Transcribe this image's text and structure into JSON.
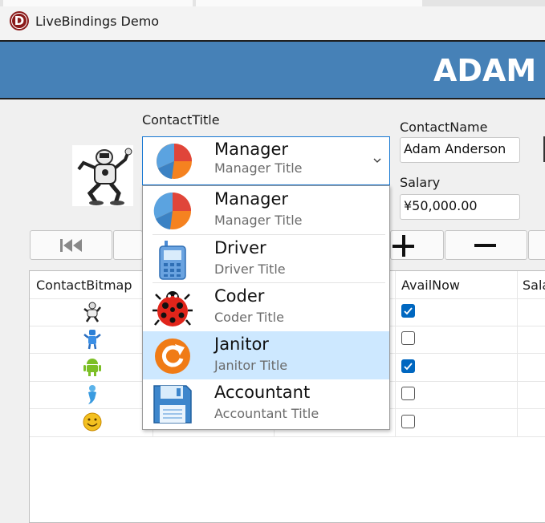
{
  "window": {
    "title": "LiveBindings Demo",
    "logo_letter": "D"
  },
  "banner": {
    "text": "ADAM A"
  },
  "form": {
    "contact_title_label": "ContactTitle",
    "contact_name_label": "ContactName",
    "contact_name_value": "Adam Anderson",
    "salary_label": "Salary",
    "salary_value": "¥50,000.00",
    "combo": {
      "title": "Manager",
      "subtitle": "Manager Title",
      "icon": "pie-chart-icon"
    }
  },
  "dropdown": {
    "items": [
      {
        "title": "Manager",
        "subtitle": "Manager Title",
        "icon": "pie-chart-icon",
        "selected": false
      },
      {
        "title": "Driver",
        "subtitle": "Driver Title",
        "icon": "mobile-phone-icon",
        "selected": false
      },
      {
        "title": "Coder",
        "subtitle": "Coder Title",
        "icon": "ladybug-icon",
        "selected": false
      },
      {
        "title": "Janitor",
        "subtitle": "Janitor Title",
        "icon": "refresh-arrow-icon",
        "selected": true
      },
      {
        "title": "Accountant",
        "subtitle": "Accountant Title",
        "icon": "floppy-disk-icon",
        "selected": false
      }
    ]
  },
  "navigator": {
    "buttons": [
      {
        "name": "first-record-button",
        "glyph": "⏮"
      },
      {
        "name": "prior-record-button",
        "glyph": ""
      },
      {
        "name": "insert-record-button",
        "glyph": "+"
      },
      {
        "name": "delete-record-button",
        "glyph": "−"
      }
    ]
  },
  "grid": {
    "columns": [
      "ContactBitmap",
      "AvailNow",
      "Sala"
    ],
    "rows": [
      {
        "bitmap": "robot-icon",
        "avail": true
      },
      {
        "bitmap": "blue-robot-icon",
        "avail": false
      },
      {
        "bitmap": "android-icon",
        "avail": true
      },
      {
        "bitmap": "genie-icon",
        "avail": false
      },
      {
        "bitmap": "smiley-icon",
        "avail": false
      }
    ]
  },
  "colors": {
    "banner": "#4681b7",
    "selection": "#cde8ff",
    "focus_border": "#1677d2",
    "checkbox": "#0067c0"
  }
}
